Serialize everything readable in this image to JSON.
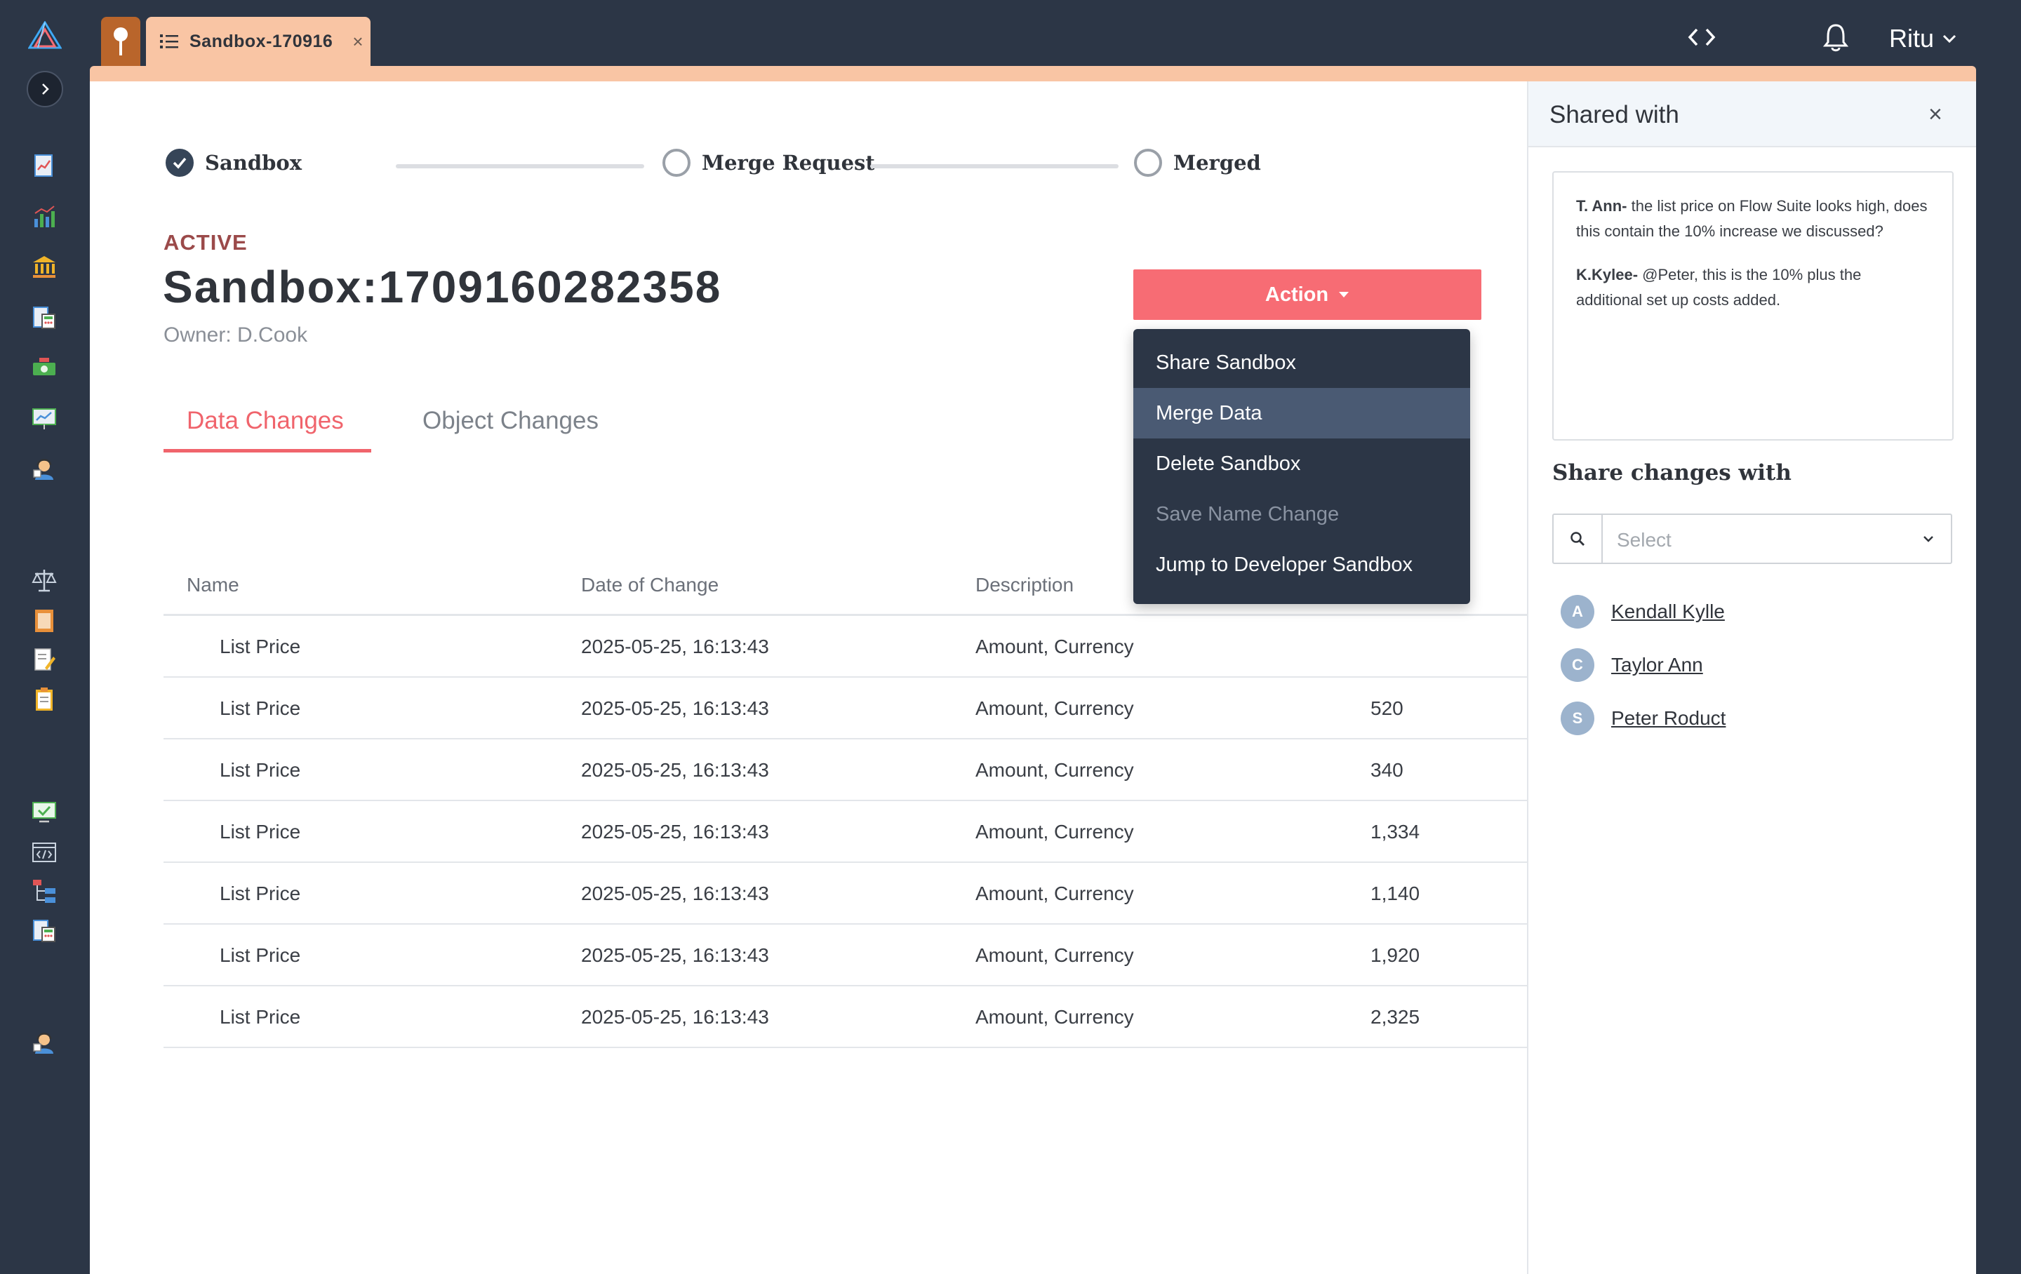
{
  "top_bar": {
    "tab_label": "Sandbox-170916",
    "tab_close": "×",
    "user_name": "Ritu"
  },
  "stepper": {
    "steps": [
      "Sandbox",
      "Merge Request",
      "Merged"
    ]
  },
  "header": {
    "status": "ACTIVE",
    "title": "Sandbox:1709160282358",
    "owner": "Owner: D.Cook",
    "action_label": "Action"
  },
  "tabs": [
    "Data Changes",
    "Object Changes"
  ],
  "table": {
    "columns": [
      "Name",
      "Date of Change",
      "Description"
    ],
    "rows": [
      {
        "name": "List Price",
        "date": "2025-05-25, 16:13:43",
        "description": "Amount, Currency",
        "value": ""
      },
      {
        "name": "List Price",
        "date": "2025-05-25, 16:13:43",
        "description": "Amount, Currency",
        "value": "520"
      },
      {
        "name": "List Price",
        "date": "2025-05-25, 16:13:43",
        "description": "Amount, Currency",
        "value": "340"
      },
      {
        "name": "List Price",
        "date": "2025-05-25, 16:13:43",
        "description": "Amount, Currency",
        "value": "1,334"
      },
      {
        "name": "List Price",
        "date": "2025-05-25, 16:13:43",
        "description": "Amount, Currency",
        "value": "1,140"
      },
      {
        "name": "List Price",
        "date": "2025-05-25, 16:13:43",
        "description": "Amount, Currency",
        "value": "1,920"
      },
      {
        "name": "List Price",
        "date": "2025-05-25, 16:13:43",
        "description": "Amount, Currency",
        "value": "2,325"
      }
    ]
  },
  "action_menu": {
    "items": [
      "Share Sandbox",
      "Merge Data",
      "Delete Sandbox",
      "Save Name Change",
      "Jump to Developer Sandbox"
    ],
    "highlighted": "Merge Data",
    "disabled": "Save Name Change"
  },
  "shared_panel": {
    "title": "Shared with",
    "close": "×",
    "comments": [
      {
        "author": "T. Ann-",
        "text": "the list price on Flow Suite looks  high, does this contain the 10% increase we discussed?"
      },
      {
        "author": "K.Kylee-",
        "text": "@Peter, this is the 10% plus the additional set up costs added."
      }
    ],
    "share_title": "Share changes with",
    "select_placeholder": "Select",
    "people": [
      {
        "initial": "A",
        "name": "Kendall Kylle"
      },
      {
        "initial": "C",
        "name": "Taylor Ann"
      },
      {
        "initial": "S",
        "name": "Peter Roduct"
      }
    ]
  },
  "colors": {
    "navy": "#2c3646",
    "accent_peach": "#f9c5a4",
    "action_red": "#f76c74",
    "tab_active": "#f0646c",
    "status_red": "#9b4a4a",
    "avatar": "#9cb3cd"
  },
  "icons": {
    "rail": [
      "report-icon",
      "bar-chart-icon",
      "bank-icon",
      "calculator-doc-icon",
      "cash-icon",
      "presentation-icon",
      "user-support-icon",
      "scale-icon",
      "book-icon",
      "edit-doc-icon",
      "clipboard-icon",
      "monitor-check-icon",
      "code-window-icon",
      "hierarchy-icon",
      "calculator-doc-icon",
      "user-support-icon"
    ]
  }
}
